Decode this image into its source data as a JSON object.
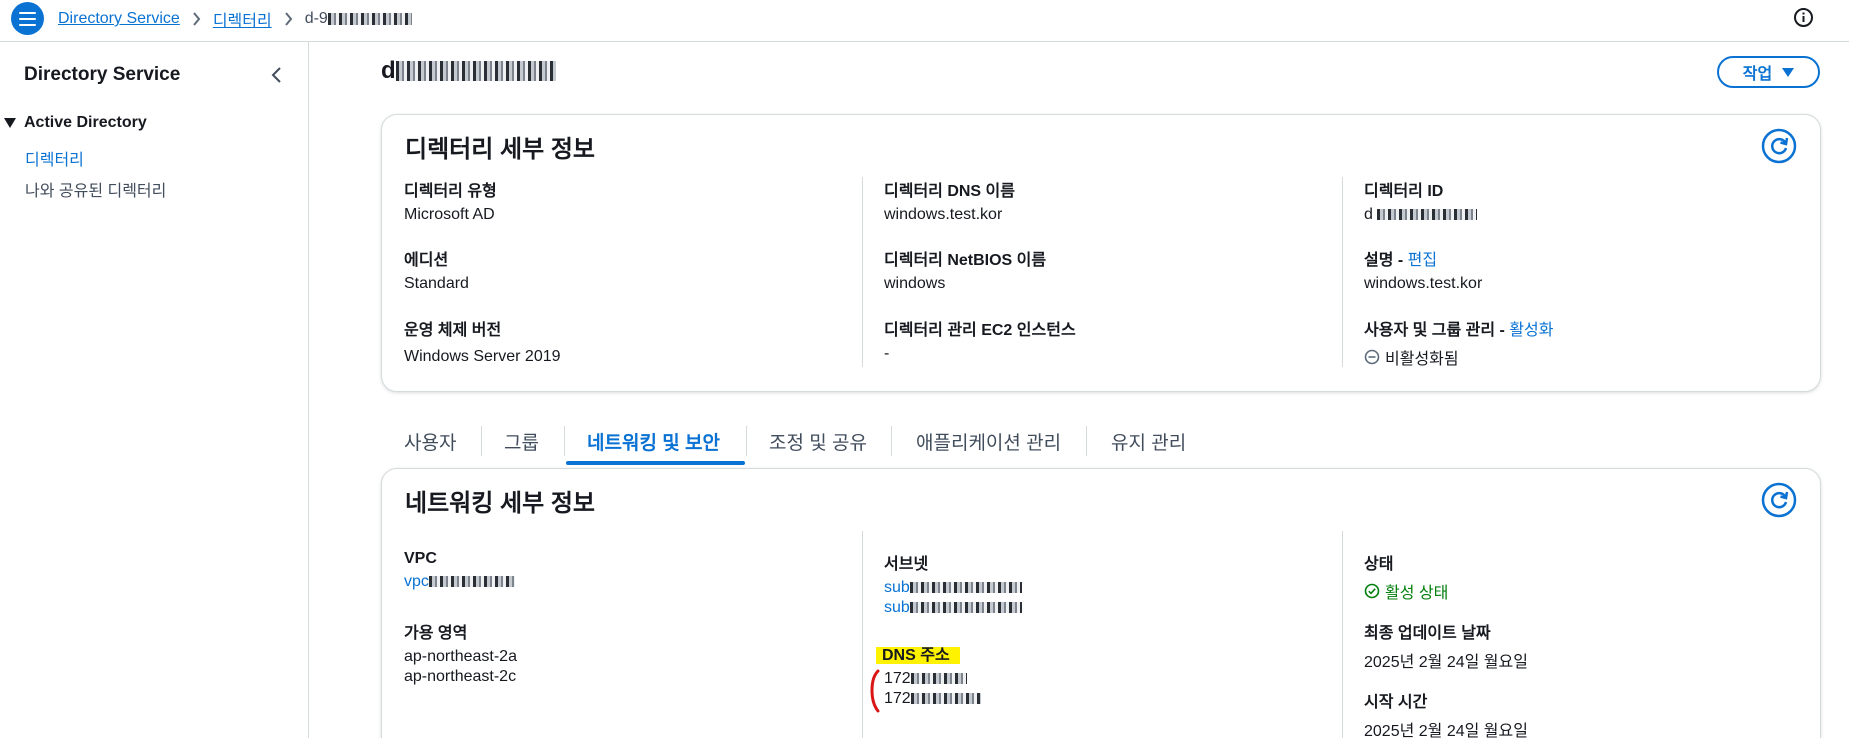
{
  "header": {
    "breadcrumbs": [
      "Directory Service",
      "디렉터리",
      "d-9"
    ],
    "menu_icon": "hamburger-icon",
    "info_icon": "info-icon"
  },
  "sidebar": {
    "title": "Directory Service",
    "section": "Active Directory",
    "items": [
      "디렉터리",
      "나와 공유된 디렉터리"
    ]
  },
  "page": {
    "title": "d",
    "action_label": "작업"
  },
  "directory_details": {
    "title": "디렉터리 세부 정보",
    "col1": {
      "type_label": "디렉터리 유형",
      "type_value": "Microsoft AD",
      "edition_label": "에디션",
      "edition_value": "Standard",
      "os_label": "운영 체제 버전",
      "os_value": "Windows Server 2019"
    },
    "col2": {
      "dns_label": "디렉터리 DNS 이름",
      "dns_value": "windows.test.kor",
      "netbios_label": "디렉터리 NetBIOS 이름",
      "netbios_value": "windows",
      "ec2_label": "디렉터리 관리 EC2 인스턴스",
      "ec2_value": "-"
    },
    "col3": {
      "id_label": "디렉터리 ID",
      "id_value": "d",
      "desc_label": "설명 -",
      "desc_edit": "편집",
      "desc_value": "windows.test.kor",
      "user_mgmt_label": "사용자 및 그룹 관리 -",
      "user_mgmt_action": "활성화",
      "user_mgmt_status": "비활성화됨"
    }
  },
  "tabs": [
    "사용자",
    "그룹",
    "네트워킹 및 보안",
    "조정 및 공유",
    "애플리케이션 관리",
    "유지 관리"
  ],
  "networking": {
    "title": "네트워킹 세부 정보",
    "vpc_label": "VPC",
    "vpc_value": "vpc",
    "az_label": "가용 영역",
    "az_values": [
      "ap-northeast-2a",
      "ap-northeast-2c"
    ],
    "subnet_label": "서브넷",
    "subnet_values": [
      "sub",
      "sub"
    ],
    "dns_label": "DNS 주소",
    "dns_values": [
      "172",
      "172"
    ],
    "status_label": "상태",
    "status_value": "활성 상태",
    "updated_label": "최종 업데이트 날짜",
    "updated_value": "2025년 2월 24일 월요일",
    "start_label": "시작 시간",
    "start_value": "2025년 2월 24일 월요일"
  },
  "colors": {
    "accent": "#0972d3",
    "success": "#037f0c",
    "highlight": "#fff200",
    "annotation": "#d91515"
  }
}
